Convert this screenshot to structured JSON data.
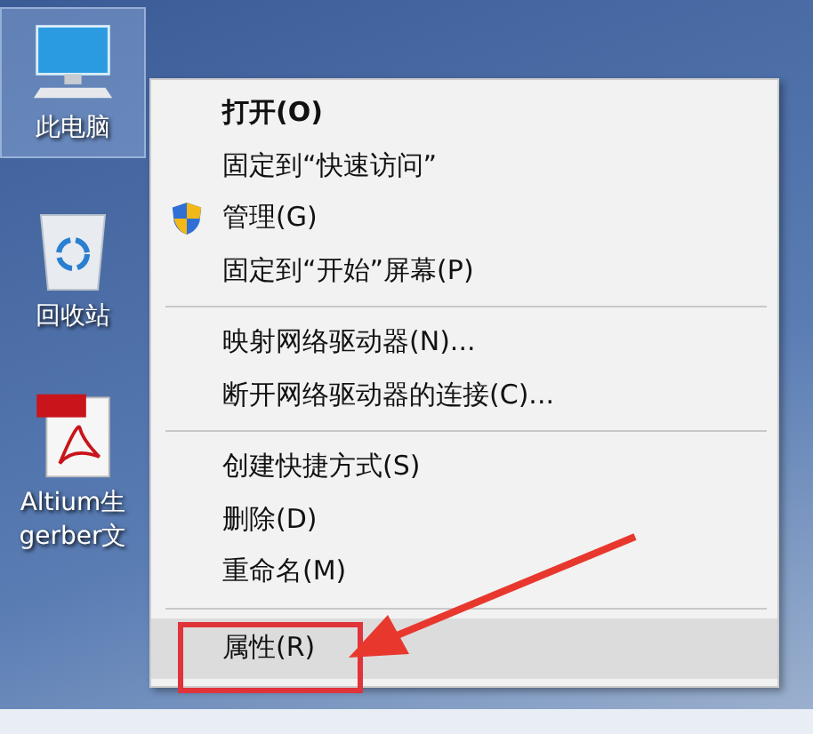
{
  "desktop_icons": [
    {
      "kind": "computer",
      "label": "此电脑",
      "selected": true
    },
    {
      "kind": "recycle",
      "label": "回收站",
      "selected": false
    },
    {
      "kind": "pdf",
      "label": "Altium生\ngerber文",
      "selected": false
    }
  ],
  "context_menu": {
    "items": [
      {
        "kind": "item",
        "label": "打开(O)",
        "bold": true,
        "shield": false,
        "selected": false
      },
      {
        "kind": "item",
        "label": "固定到“快速访问”",
        "bold": false,
        "shield": false,
        "selected": false
      },
      {
        "kind": "item",
        "label": "管理(G)",
        "bold": false,
        "shield": true,
        "selected": false
      },
      {
        "kind": "item",
        "label": "固定到“开始”屏幕(P)",
        "bold": false,
        "shield": false,
        "selected": false
      },
      {
        "kind": "separator"
      },
      {
        "kind": "item",
        "label": "映射网络驱动器(N)...",
        "bold": false,
        "shield": false,
        "selected": false
      },
      {
        "kind": "item",
        "label": "断开网络驱动器的连接(C)...",
        "bold": false,
        "shield": false,
        "selected": false
      },
      {
        "kind": "separator"
      },
      {
        "kind": "item",
        "label": "创建快捷方式(S)",
        "bold": false,
        "shield": false,
        "selected": false
      },
      {
        "kind": "item",
        "label": "删除(D)",
        "bold": false,
        "shield": false,
        "selected": false
      },
      {
        "kind": "item",
        "label": "重命名(M)",
        "bold": false,
        "shield": false,
        "selected": false
      },
      {
        "kind": "separator"
      },
      {
        "kind": "item",
        "label": "属性(R)",
        "bold": false,
        "shield": false,
        "selected": true
      }
    ]
  }
}
